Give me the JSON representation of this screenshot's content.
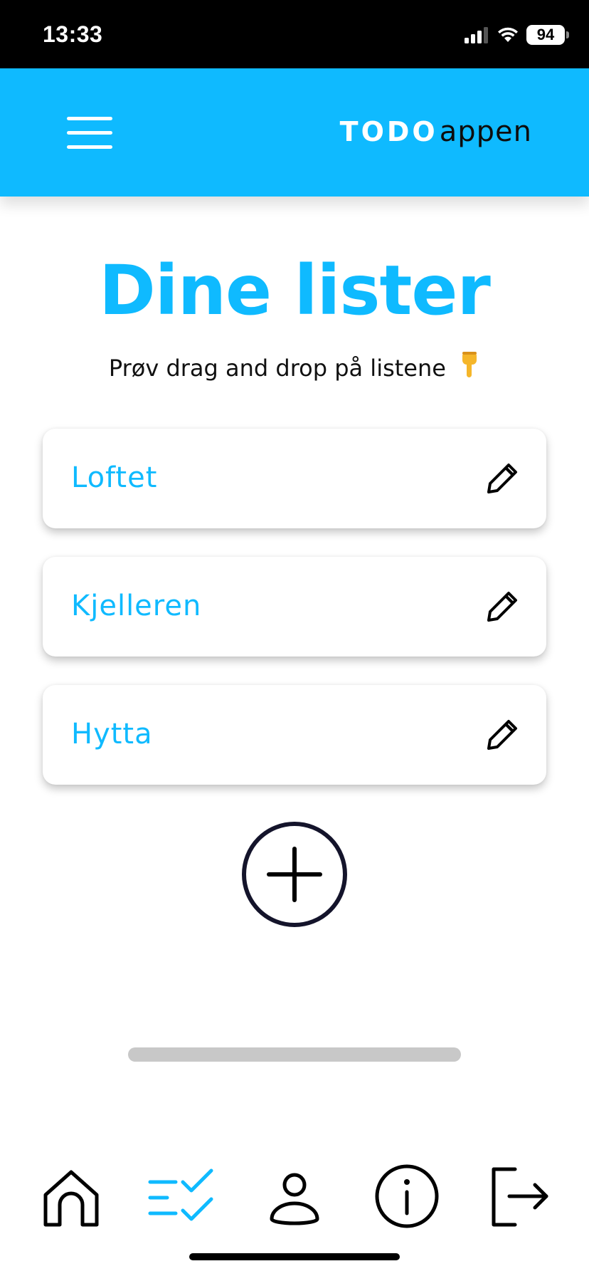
{
  "status_bar": {
    "time": "13:33",
    "battery_level": "94",
    "icons": [
      "cellular-signal-icon",
      "wifi-icon",
      "battery-icon"
    ]
  },
  "header": {
    "menu_icon": "hamburger-menu-icon",
    "logo_bold": "TODO",
    "logo_light": "appen",
    "background_color": "#0fbaff"
  },
  "main": {
    "title": "Dine lister",
    "subtitle": "Prøv drag and drop på listene",
    "subtitle_emoji": "👇",
    "lists": [
      {
        "label": "Loftet",
        "icon": "pencil-edit-icon"
      },
      {
        "label": "Kjelleren",
        "icon": "pencil-edit-icon"
      },
      {
        "label": "Hytta",
        "icon": "pencil-edit-icon"
      }
    ],
    "add_button_icon": "plus-circle-icon"
  },
  "bottom_nav": {
    "items": [
      {
        "icon": "home-icon",
        "active": false
      },
      {
        "icon": "checklist-icon",
        "active": true
      },
      {
        "icon": "user-icon",
        "active": false
      },
      {
        "icon": "info-icon",
        "active": false
      },
      {
        "icon": "logout-icon",
        "active": false
      }
    ],
    "active_color": "#0fbaff"
  },
  "colors": {
    "accent": "#0fbaff",
    "dark": "#14142b"
  }
}
